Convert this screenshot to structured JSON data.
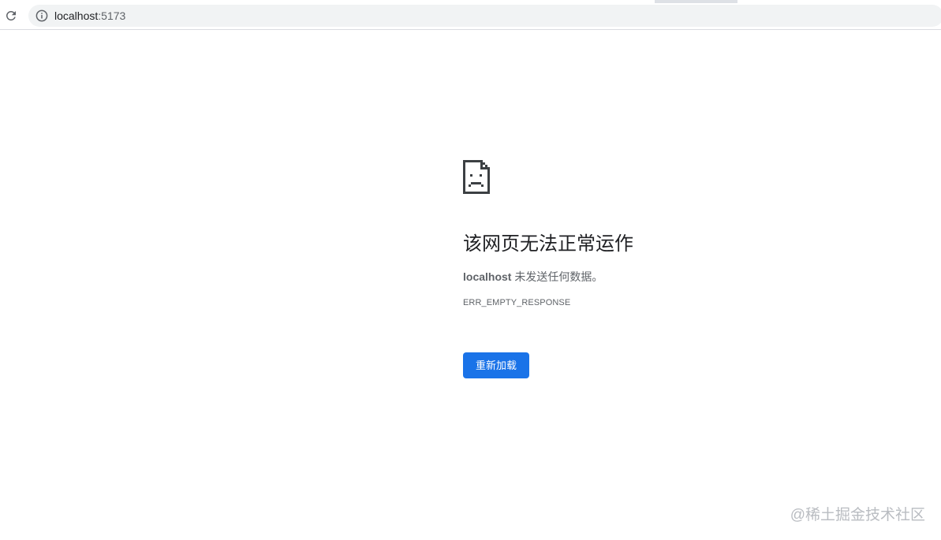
{
  "browser": {
    "url_host": "localhost",
    "url_port": ":5173"
  },
  "error": {
    "title": "该网页无法正常运作",
    "description_host": "localhost",
    "description_text": " 未发送任何数据。",
    "code": "ERR_EMPTY_RESPONSE",
    "reload_label": "重新加载"
  },
  "watermark": "@稀土掘金技术社区",
  "colors": {
    "button": "#1a73e8",
    "omnibox": "#f1f3f4",
    "text_primary": "#202124",
    "text_secondary": "#5f6368"
  },
  "icons": {
    "reload": "reload-icon",
    "info": "info-icon",
    "error": "sad-document-icon"
  }
}
